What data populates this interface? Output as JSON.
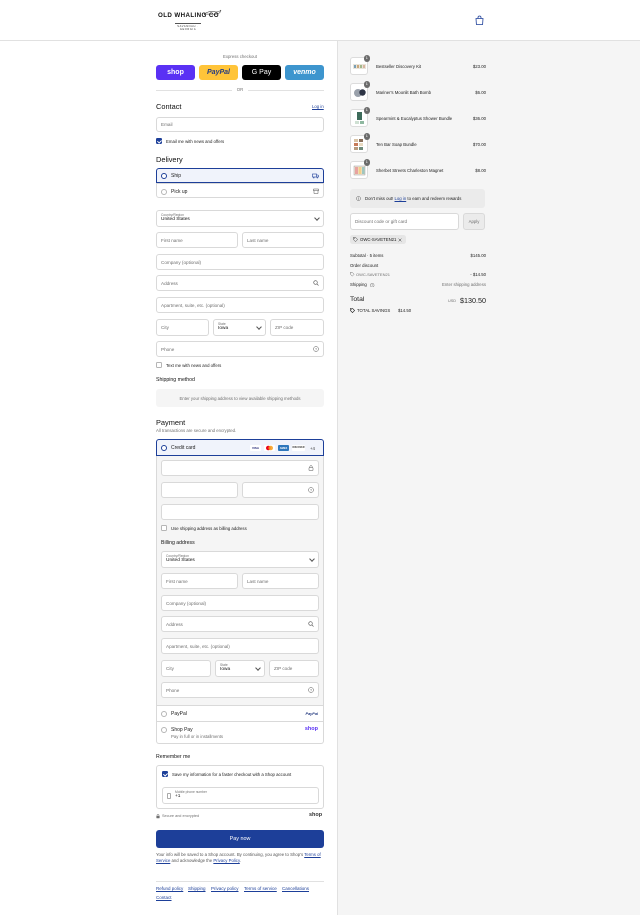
{
  "header": {
    "brand": "OLD WHALING CO",
    "brand_sub": "SAVANNAH · GEORGIA",
    "cart_icon": "shopping-bag-icon"
  },
  "express": {
    "label": "Express checkout",
    "shop": "shop",
    "paypal": "PayPal",
    "gpay": "G Pay",
    "venmo": "venmo",
    "or": "OR"
  },
  "contact": {
    "title": "Contact",
    "login": "Log in",
    "email_placeholder": "Email",
    "news_label": "Email me with news and offers"
  },
  "delivery": {
    "title": "Delivery",
    "ship": "Ship",
    "pickup": "Pick up",
    "country_label": "Country/Region",
    "country_value": "United States",
    "first_name": "First name",
    "last_name": "Last name",
    "company": "Company (optional)",
    "address": "Address",
    "apartment": "Apartment, suite, etc. (optional)",
    "city": "City",
    "state_label": "State",
    "state_value": "Iowa",
    "zip": "ZIP code",
    "phone": "Phone",
    "text_label": "Text me with news and offers"
  },
  "shipping_method": {
    "title": "Shipping method",
    "message": "Enter your shipping address to view available shipping methods"
  },
  "payment": {
    "title": "Payment",
    "subtitle": "All transactions are secure and encrypted.",
    "credit_card": "Credit card",
    "cards": [
      "VISA",
      "MC",
      "AMEX",
      "DISCOVER"
    ],
    "more_cards": "+4",
    "use_shipping": "Use shipping address as billing address",
    "billing_title": "Billing address",
    "paypal": "PayPal",
    "paypal_logo": "PayPal",
    "shop_pay": "Shop Pay",
    "shop_pay_sub": "Pay in full or in installments",
    "shop_logo": "shop"
  },
  "remember": {
    "title": "Remember me",
    "save_label": "Save my information for a faster checkout with a Shop account",
    "mobile_label": "Mobile phone number",
    "mobile_value": "+1",
    "secure": "Secure and encrypted",
    "shop_logo": "shop"
  },
  "pay_now": "Pay now",
  "legal": {
    "text1": "Your info will be saved to a Shop account. By continuing, you agree to Shop's",
    "tos": "Terms of Service",
    "text2": "and acknowledge the",
    "privacy": "Privacy Policy",
    "end": "."
  },
  "footer": [
    "Refund policy",
    "Shipping",
    "Privacy policy",
    "Terms of service",
    "Cancellations",
    "Contact"
  ],
  "cart": {
    "items": [
      {
        "name": "Bestseller Discovery Kit",
        "qty": "1",
        "price": "$23.00"
      },
      {
        "name": "Mariner's Moonlit Bath Bomb",
        "qty": "1",
        "price": "$6.00"
      },
      {
        "name": "Spearmint & Eucalyptus Shower Bundle",
        "qty": "1",
        "price": "$36.00"
      },
      {
        "name": "Ten Bar Soap Bundle",
        "qty": "1",
        "price": "$70.00"
      },
      {
        "name": "Sherbet Streets Charleston Magnet",
        "qty": "1",
        "price": "$8.00"
      }
    ],
    "rewards": {
      "pre": "Don't miss out!",
      "link": "Log in",
      "post": "to earn and redeem rewards"
    },
    "discount_placeholder": "Discount code or gift card",
    "apply": "Apply",
    "code": "OWC-SAVETEN21",
    "subtotal_label": "Subtotal · 5 items",
    "subtotal": "$145.00",
    "order_discount": "Order discount",
    "discount_code": "OWC-SAVETEN21",
    "discount_amount": "- $14.50",
    "shipping_label": "Shipping",
    "shipping_value": "Enter shipping address",
    "total_label": "Total",
    "currency": "USD",
    "total": "$130.50",
    "savings_label": "TOTAL SAVINGS",
    "savings": "$14.50"
  }
}
